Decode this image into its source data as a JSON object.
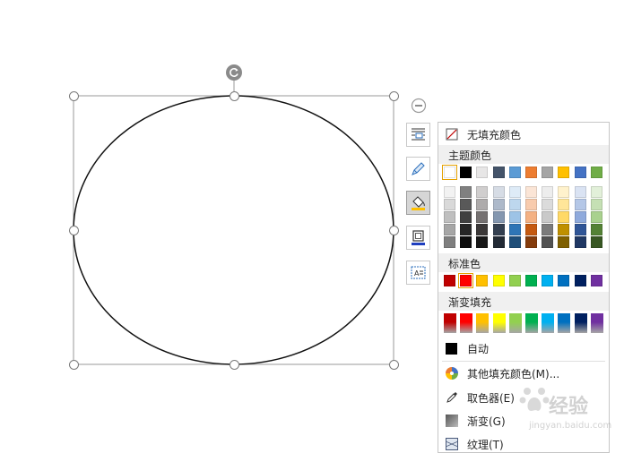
{
  "menu": {
    "no_fill": "无填充颜色",
    "theme_colors": "主题颜色",
    "standard_colors": "标准色",
    "gradient_fill": "渐变填充",
    "automatic": "自动",
    "more_fill_colors": "其他填充颜色(M)...",
    "eyedropper": "取色器(E)",
    "gradient": "渐变(G)",
    "texture": "纹理(T)"
  },
  "watermark": {
    "text": "经验",
    "subtext": "jingyan.baidu.com"
  },
  "colors": {
    "theme_top": [
      "#ffffff",
      "#000000",
      "#e7e6e6",
      "#44546a",
      "#5b9bd5",
      "#ed7d31",
      "#a5a5a5",
      "#ffc000",
      "#4472c4",
      "#70ad47"
    ],
    "theme_shades": [
      [
        "#f2f2f2",
        "#808080",
        "#d0cece",
        "#d6dce5",
        "#deebf7",
        "#fbe5d6",
        "#ededed",
        "#fff2cc",
        "#dae3f3",
        "#e2f0d9"
      ],
      [
        "#d9d9d9",
        "#595959",
        "#aeabab",
        "#adb9ca",
        "#bdd7ee",
        "#f8cbad",
        "#dbdbdb",
        "#ffe699",
        "#b4c7e7",
        "#c5e0b4"
      ],
      [
        "#bfbfbf",
        "#404040",
        "#757171",
        "#8497b0",
        "#9dc3e6",
        "#f4b183",
        "#c9c9c9",
        "#ffd966",
        "#8faadc",
        "#a9d18e"
      ],
      [
        "#a6a6a6",
        "#262626",
        "#3b3838",
        "#333f50",
        "#2e75b6",
        "#c55a11",
        "#7b7b7b",
        "#bf9000",
        "#2f5597",
        "#548235"
      ],
      [
        "#7f7f7f",
        "#0d0d0d",
        "#171717",
        "#222a35",
        "#1f4e79",
        "#843c0c",
        "#525252",
        "#7f6000",
        "#203864",
        "#385723"
      ]
    ],
    "standard": [
      "#c00000",
      "#ff0000",
      "#ffc000",
      "#ffff00",
      "#92d050",
      "#00b050",
      "#00b0f0",
      "#0070c0",
      "#002060",
      "#7030a0"
    ],
    "gradient": [
      "#c00000",
      "#ff0000",
      "#ffc000",
      "#ffff00",
      "#92d050",
      "#00b050",
      "#00b0f0",
      "#0070c0",
      "#002060",
      "#7030a0"
    ],
    "auto": "#000000",
    "selection_outline": "#e5a100"
  },
  "icons": [
    "rotate-icon",
    "minus-circle-icon",
    "layout-options-icon",
    "pen-icon",
    "fill-bucket-icon",
    "outline-icon",
    "text-box-icon",
    "no-fill-icon",
    "color-wheel-icon",
    "eyedropper-icon",
    "gradient-icon",
    "texture-icon"
  ]
}
